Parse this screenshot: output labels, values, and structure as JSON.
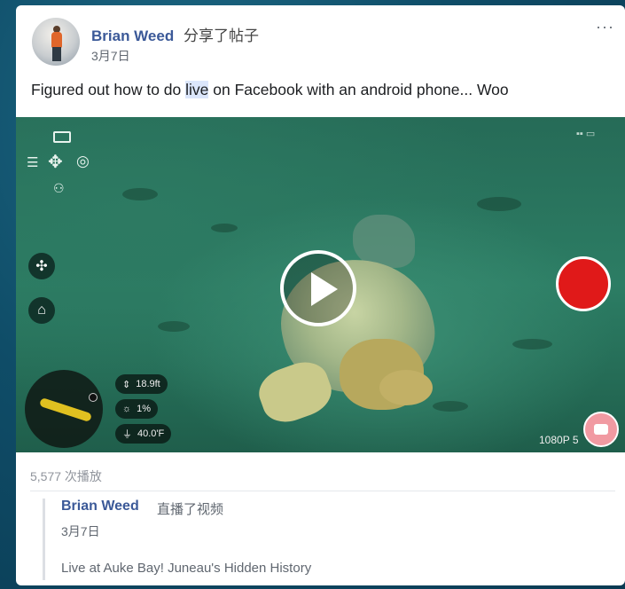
{
  "post": {
    "author": "Brian Weed",
    "action": "分享了帖子",
    "date": "3月7日",
    "more": "···",
    "text_before": "Figured out how to do ",
    "text_highlight": "live",
    "text_after": " on Facebook with an android phone... Woo"
  },
  "video": {
    "hud": {
      "altitude": "18.9ft",
      "light": "1%",
      "depth": "40.0'F",
      "resolution": "1080P",
      "resolution_suffix": "5"
    },
    "icons": {
      "battery": "battery-icon",
      "settings": "sliders-icon",
      "dpad": "dpad-icon",
      "target": "target-icon",
      "controller": "gamepad-icon",
      "fan": "fan-icon",
      "home": "home-icon",
      "play": "play-icon",
      "record": "record-icon"
    },
    "colors": {
      "record": "#e01919",
      "water": "#2c7d64"
    }
  },
  "stats": {
    "views": "5,577 次播放"
  },
  "shared": {
    "author": "Brian Weed",
    "action": "直播了视频",
    "date": "3月7日",
    "title": "Live at Auke Bay! Juneau's Hidden History"
  }
}
